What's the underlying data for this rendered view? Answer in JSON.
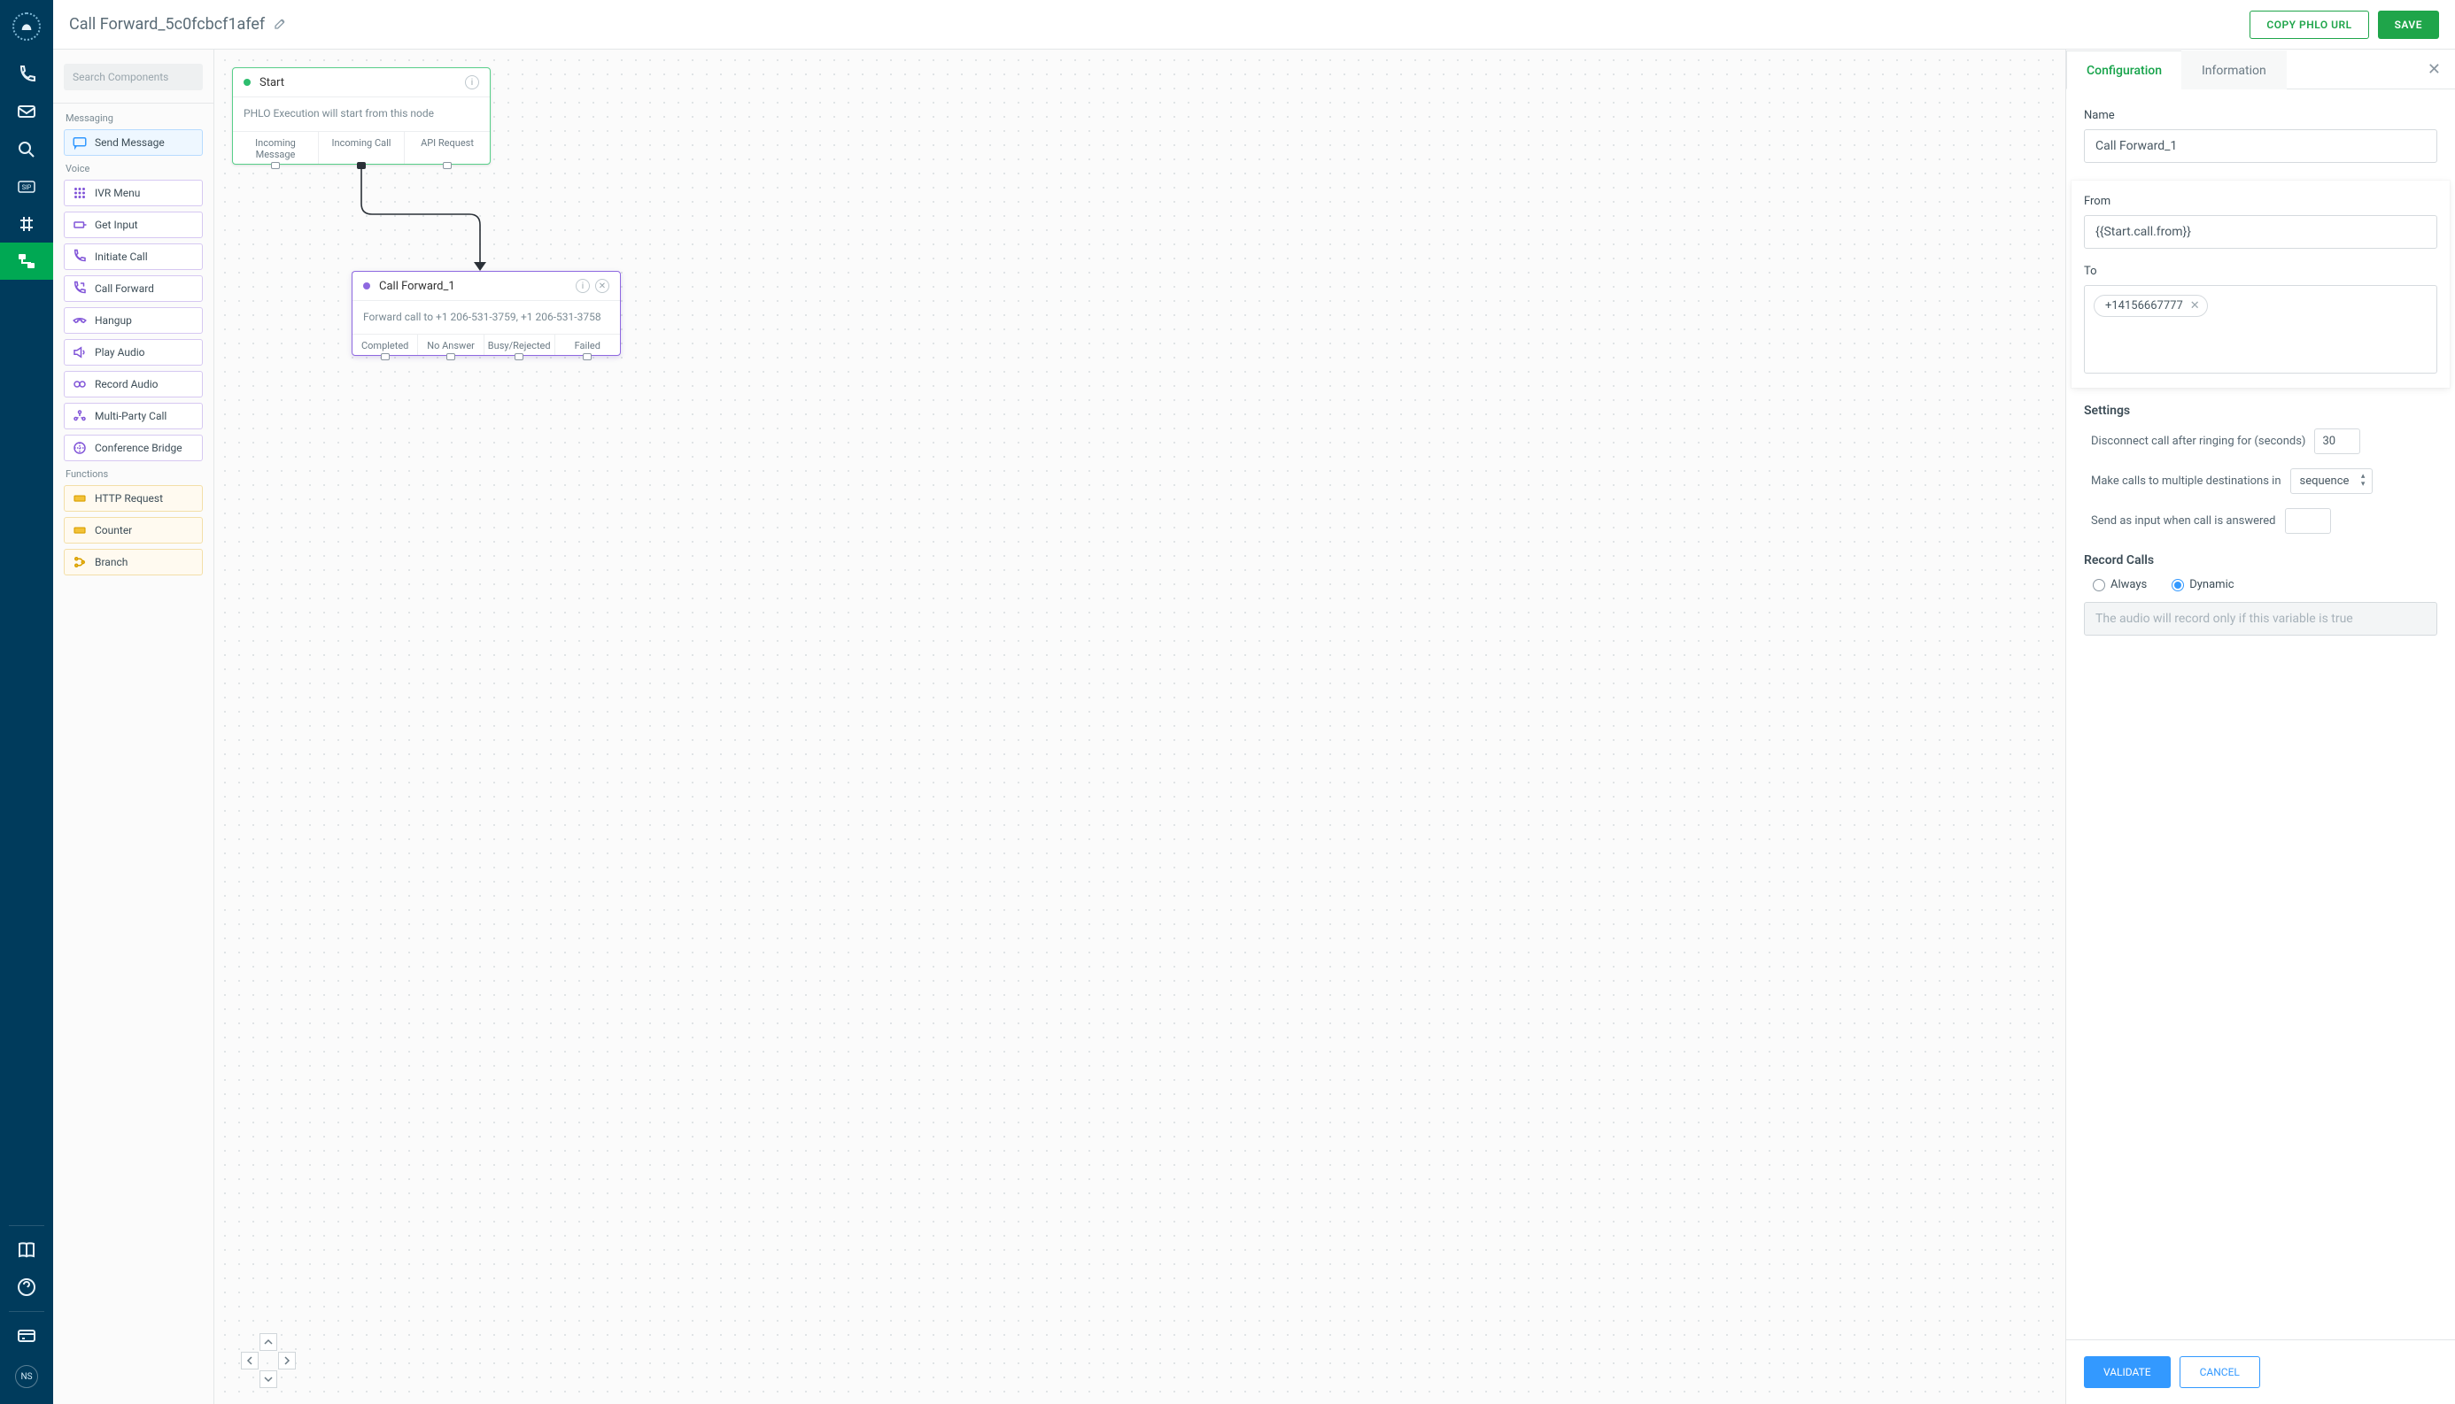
{
  "topbar": {
    "title": "Call Forward_5c0fcbcf1afef",
    "copy_url_label": "COPY PHLO URL",
    "save_label": "SAVE"
  },
  "nav_ns": "NS",
  "search": {
    "placeholder": "Search Components"
  },
  "sections": {
    "messaging_label": "Messaging",
    "voice_label": "Voice",
    "functions_label": "Functions"
  },
  "components": {
    "send_message": "Send Message",
    "ivr_menu": "IVR Menu",
    "get_input": "Get Input",
    "initiate_call": "Initiate Call",
    "call_forward": "Call Forward",
    "hangup": "Hangup",
    "play_audio": "Play Audio",
    "record_audio": "Record Audio",
    "multi_party_call": "Multi-Party Call",
    "conference_bridge": "Conference Bridge",
    "http_request": "HTTP Request",
    "counter": "Counter",
    "branch": "Branch"
  },
  "start_node": {
    "title": "Start",
    "body": "PHLO Execution will start from this node",
    "out1": "Incoming Message",
    "out2": "Incoming Call",
    "out3": "API Request"
  },
  "cf_node": {
    "title": "Call Forward_1",
    "body": "Forward call to +1 206-531-3759, +1 206-531-3758",
    "out1": "Completed",
    "out2": "No Answer",
    "out3": "Busy/Rejected",
    "out4": "Failed"
  },
  "config": {
    "tab_config": "Configuration",
    "tab_info": "Information",
    "name_label": "Name",
    "name_value": "Call Forward_1",
    "from_label": "From",
    "from_value": "{{Start.call.from}}",
    "to_label": "To",
    "to_tag": "+14156667777",
    "settings_label": "Settings",
    "ring_label": "Disconnect call after ringing for (seconds)",
    "ring_value": "30",
    "multi_label": "Make calls to multiple destinations in",
    "multi_value": "sequence",
    "send_input_label": "Send as input when call is answered",
    "record_label": "Record Calls",
    "radio_always": "Always",
    "radio_dynamic": "Dynamic",
    "dynamic_placeholder": "The audio will record only if this variable is true",
    "validate_label": "VALIDATE",
    "cancel_label": "CANCEL"
  }
}
